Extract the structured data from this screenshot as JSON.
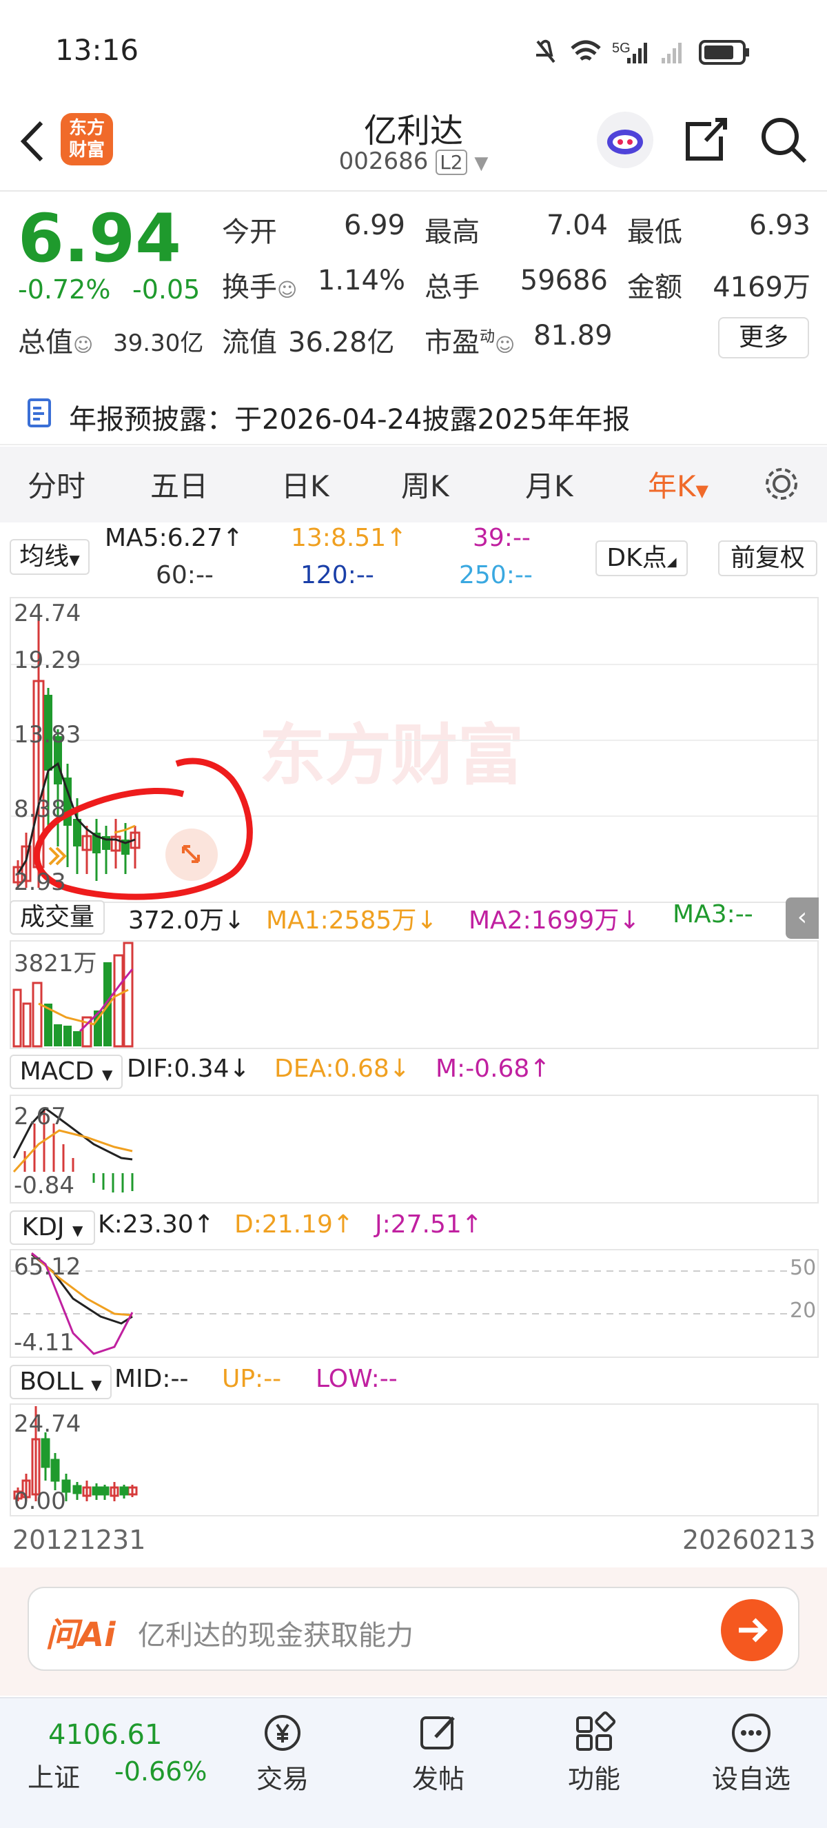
{
  "status_bar": {
    "time": "13:16",
    "network": "5G"
  },
  "header": {
    "logo_text": "东方财富",
    "name": "亿利达",
    "code": "002686",
    "level": "L2"
  },
  "quote": {
    "price": "6.94",
    "change_pct": "-0.72%",
    "change": "-0.05",
    "open_label": "今开",
    "open": "6.99",
    "high_label": "最高",
    "high": "7.04",
    "low_label": "最低",
    "low": "6.93",
    "turnover_label": "换手",
    "turnover": "1.14%",
    "volume_label": "总手",
    "volume": "59686",
    "amount_label": "金额",
    "amount": "4169万",
    "mktcap_label": "总值",
    "mktcap": "39.30亿",
    "float_label": "流值",
    "float": "36.28亿",
    "pe_label": "市盈",
    "pe_sup": "动",
    "pe": "81.89",
    "more": "更多"
  },
  "notice": {
    "text": "年报预披露：于2026-04-24披露2025年年报"
  },
  "tabs": [
    "分时",
    "五日",
    "日K",
    "周K",
    "月K",
    "年K"
  ],
  "ma_bar": {
    "selector": "均线",
    "ma5": "MA5:6.27↑",
    "ma13": "13:8.51↑",
    "ma39": "39:--",
    "ma60": "60:--",
    "ma120": "120:--",
    "ma250": "250:--",
    "dk": "DK点",
    "adjust": "前复权"
  },
  "kline": {
    "labels": [
      "24.74",
      "19.29",
      "13.83",
      "8.38",
      "2.93"
    ],
    "watermark": "东方财富"
  },
  "volume": {
    "label": "成交量",
    "value": "372.0万↓",
    "ma1": "MA1:2585万↓",
    "ma2": "MA2:1699万↓",
    "ma3": "MA3:--",
    "axis_max": "3821万"
  },
  "macd": {
    "selector": "MACD",
    "dif": "DIF:0.34↓",
    "dea": "DEA:0.68↓",
    "m": "M:-0.68↑",
    "axis_max": "2.67",
    "axis_min": "-0.84"
  },
  "kdj": {
    "selector": "KDJ",
    "k": "K:23.30↑",
    "d": "D:21.19↑",
    "j": "J:27.51↑",
    "axis_max": "65.12",
    "axis_min": "-4.11",
    "ref50": "50",
    "ref20": "20"
  },
  "boll": {
    "selector": "BOLL",
    "mid": "MID:--",
    "up": "UP:--",
    "low": "LOW:--",
    "axis_max": "24.74",
    "axis_min": "0.00"
  },
  "date_range": {
    "start": "20121231",
    "end": "20260213"
  },
  "ai": {
    "logo": "问Ai",
    "prompt": "亿利达的现金获取能力"
  },
  "bottom_nav": {
    "index_value": "4106.61",
    "index_name": "上证",
    "index_change": "-0.66%",
    "items": [
      "交易",
      "发帖",
      "功能",
      "设自选"
    ]
  },
  "colors": {
    "up": "#d63a3a",
    "down": "#1f9a2d",
    "accent": "#f06a2a"
  }
}
